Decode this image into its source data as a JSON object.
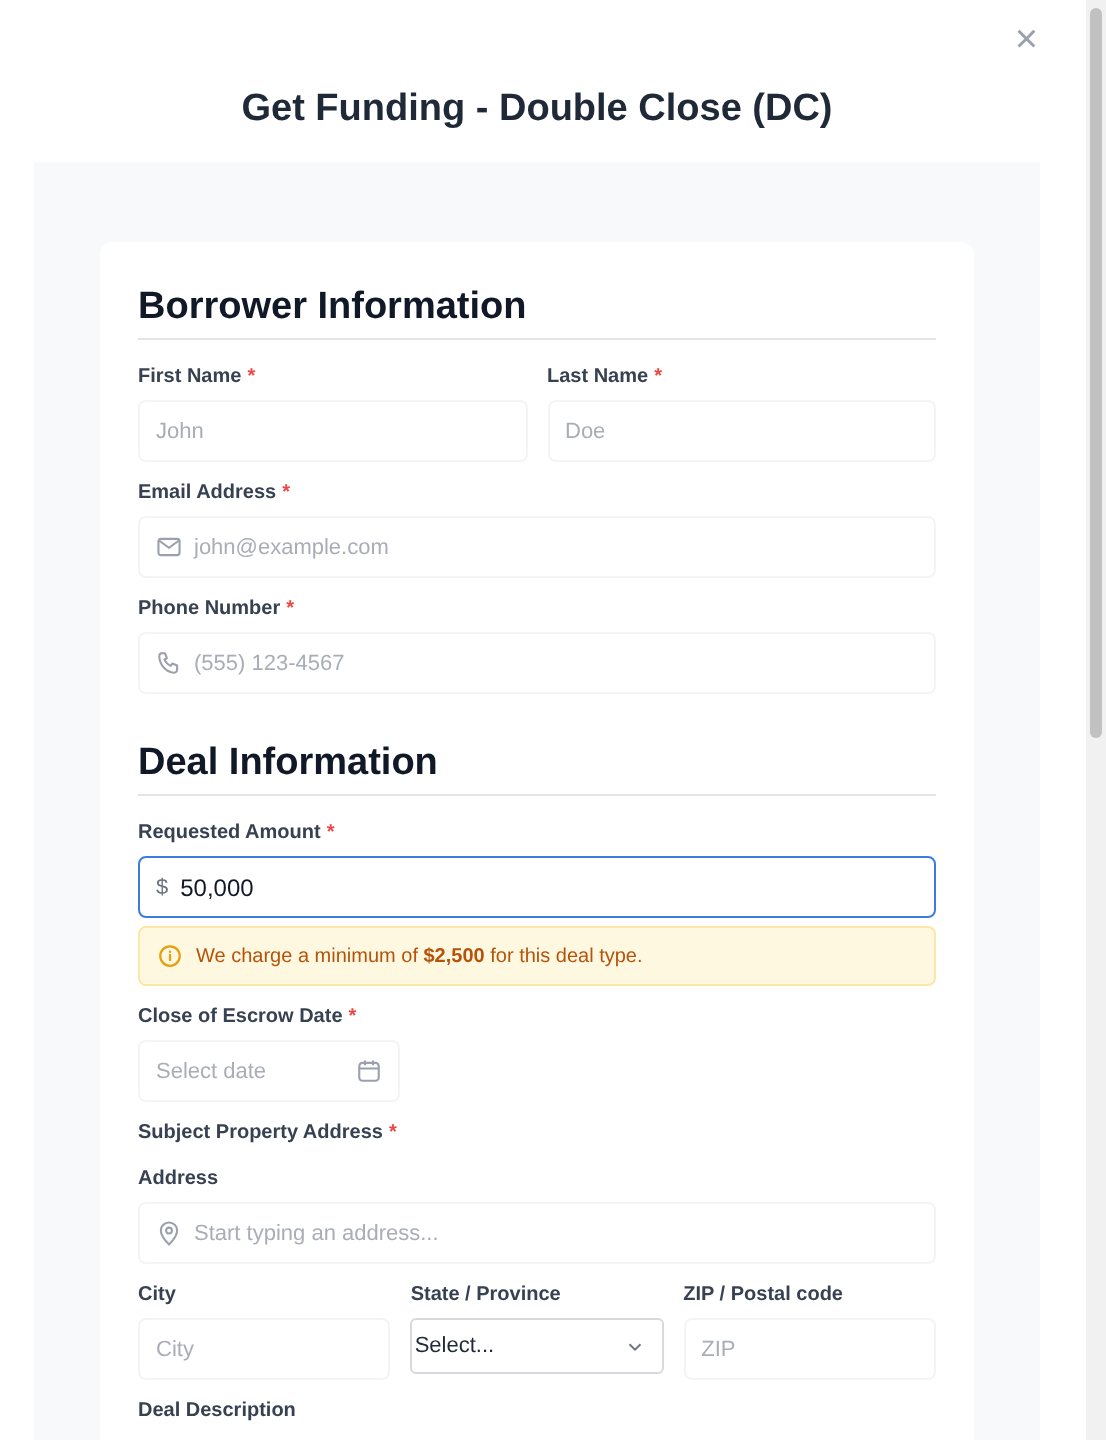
{
  "dialog": {
    "title": "Get Funding - Double Close (DC)",
    "close": "×"
  },
  "sections": [
    {
      "heading": "Borrower Information",
      "rows": [
        [
          {
            "kind": "text",
            "label": "First Name",
            "required_mark": "*",
            "placeholder": "John"
          },
          {
            "kind": "text",
            "label": "Last Name",
            "required_mark": "*",
            "placeholder": "Doe"
          }
        ],
        [
          {
            "kind": "email",
            "label": "Email Address",
            "required_mark": "*",
            "placeholder": "john@example.com"
          }
        ],
        [
          {
            "kind": "phone",
            "label": "Phone Number",
            "required_mark": "*",
            "placeholder": "(555) 123-4567"
          }
        ]
      ]
    },
    {
      "heading": "Deal Information",
      "rows": [
        [
          {
            "kind": "amount",
            "label": "Requested Amount",
            "required_mark": "*",
            "prefix": "$",
            "value": "50,000",
            "focused": true
          }
        ],
        [
          {
            "kind": "notice",
            "text": "We charge a minimum of **$2,500** for this deal type."
          }
        ],
        [
          {
            "kind": "date",
            "label": "Close of Escrow Date",
            "required_mark": "*",
            "placeholder": "Select date"
          }
        ],
        [
          {
            "kind": "heading",
            "label": "Subject Property Address",
            "required_mark": "*"
          }
        ],
        [
          {
            "kind": "address",
            "label": "Address",
            "placeholder": "Start typing an address..."
          }
        ],
        [
          {
            "kind": "text",
            "label": "City",
            "placeholder": "City"
          },
          {
            "kind": "select",
            "label": "State / Province",
            "value": "Select..."
          },
          {
            "kind": "text",
            "label": "ZIP / Postal code",
            "placeholder": "ZIP"
          }
        ],
        [
          {
            "kind": "heading",
            "label": "Deal Description"
          }
        ]
      ]
    }
  ]
}
